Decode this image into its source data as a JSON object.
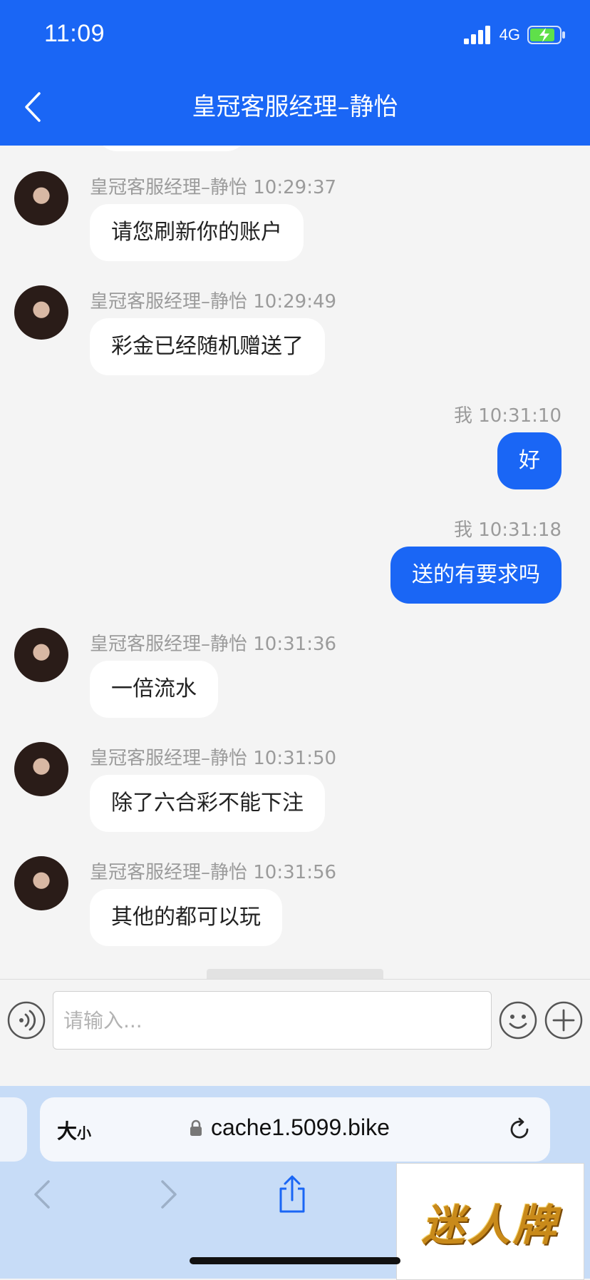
{
  "status_bar": {
    "time": "11:09",
    "network": "4G"
  },
  "header": {
    "title": "皇冠客服经理–静怡"
  },
  "messages": [
    {
      "side": "left",
      "sender": "皇冠客服经理–静怡 10:29:37",
      "text": "请您刷新你的账户"
    },
    {
      "side": "left",
      "sender": "皇冠客服经理–静怡 10:29:49",
      "text": "彩金已经随机赠送了"
    },
    {
      "side": "right",
      "sender": "我 10:31:10",
      "text": "好"
    },
    {
      "side": "right",
      "sender": "我 10:31:18",
      "text": "送的有要求吗"
    },
    {
      "side": "left",
      "sender": "皇冠客服经理–静怡 10:31:36",
      "text": "一倍流水"
    },
    {
      "side": "left",
      "sender": "皇冠客服经理–静怡 10:31:50",
      "text": "除了六合彩不能下注"
    },
    {
      "side": "left",
      "sender": "皇冠客服经理–静怡 10:31:56",
      "text": "其他的都可以玩"
    }
  ],
  "input": {
    "placeholder": "请输入..."
  },
  "browser": {
    "reader_size_big": "大",
    "reader_size_small": "小",
    "url": "cache1.5099.bike"
  },
  "watermark": {
    "text": "迷人牌"
  },
  "colors": {
    "primary": "#1a66f5",
    "background": "#f4f4f4"
  }
}
